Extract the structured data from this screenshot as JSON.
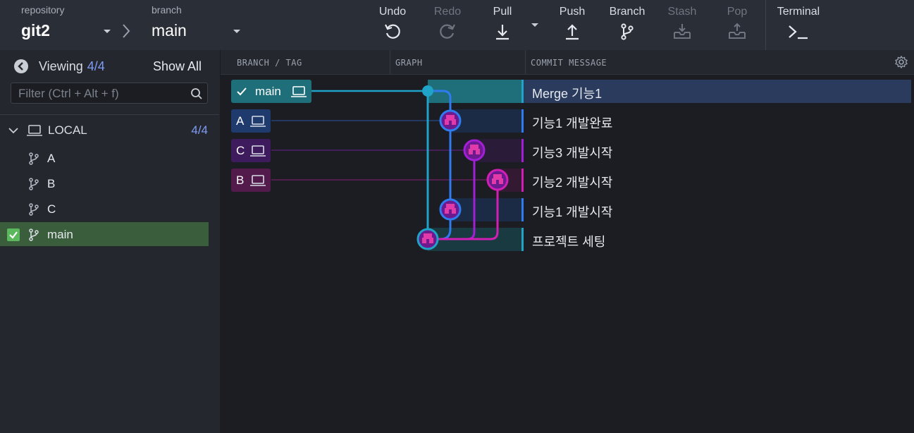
{
  "toolbar": {
    "repository_label": "repository",
    "repository_name": "git2",
    "branch_label": "branch",
    "branch_name": "main",
    "actions": {
      "undo": "Undo",
      "redo": "Redo",
      "pull": "Pull",
      "push": "Push",
      "branch": "Branch",
      "stash": "Stash",
      "pop": "Pop",
      "terminal": "Terminal"
    }
  },
  "sidebar": {
    "viewing_label": "Viewing",
    "viewing_count": "4/4",
    "show_all": "Show All",
    "filter_placeholder": "Filter (Ctrl + Alt + f)",
    "local": {
      "label": "LOCAL",
      "count": "4/4"
    },
    "branches": [
      {
        "name": "A",
        "active": false
      },
      {
        "name": "B",
        "active": false
      },
      {
        "name": "C",
        "active": false
      },
      {
        "name": "main",
        "active": true
      }
    ]
  },
  "graph_header": {
    "branch_tag": "BRANCH / TAG",
    "graph": "GRAPH",
    "commit_message": "COMMIT MESSAGE"
  },
  "refs": [
    {
      "name": "main",
      "checked": true,
      "color": "#1e6f7a"
    },
    {
      "name": "A",
      "checked": false,
      "color": "#1f3b6e"
    },
    {
      "name": "C",
      "checked": false,
      "color": "#3e1b5c"
    },
    {
      "name": "B",
      "checked": false,
      "color": "#521b4c"
    }
  ],
  "commits": [
    {
      "message": "Merge 기능1",
      "selected": true
    },
    {
      "message": "기능1 개발완료",
      "selected": false
    },
    {
      "message": "기능3 개발시작",
      "selected": false
    },
    {
      "message": "기능2 개발시작",
      "selected": false
    },
    {
      "message": "기능1 개발시작",
      "selected": false
    },
    {
      "message": "프로젝트 세팅",
      "selected": false
    }
  ],
  "colors": {
    "main_lane": "#1fa3c9",
    "a_lane": "#2f7bf0",
    "c_lane": "#a31fd6",
    "b_lane": "#d11fb5",
    "selected_row": "#2a3b5e",
    "active_branch": "#3a5d3b",
    "accent_count": "#7f9cf5"
  },
  "icons": [
    "undo-icon",
    "redo-icon",
    "pull-icon",
    "push-icon",
    "branch-icon",
    "stash-icon",
    "pop-icon",
    "terminal-icon",
    "search-icon",
    "laptop-icon",
    "gear-icon",
    "check-icon",
    "back-icon"
  ]
}
